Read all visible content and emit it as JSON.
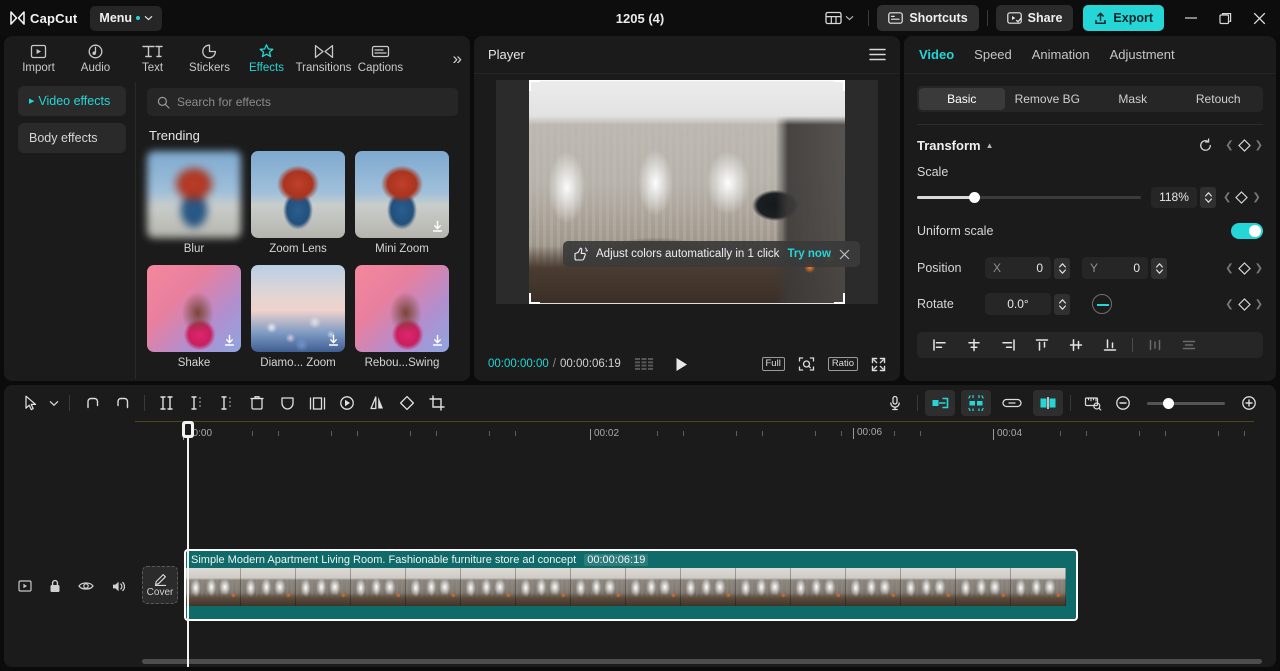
{
  "titlebar": {
    "brand": "CapCut",
    "menu_label": "Menu",
    "project_title": "1205 (4)",
    "layout_icon": "layout-icon",
    "shortcuts_label": "Shortcuts",
    "share_label": "Share",
    "export_label": "Export",
    "minimize": "minimize-icon",
    "maximize": "restore-icon",
    "close": "close-icon",
    "accent": "#25d6d6"
  },
  "nav": {
    "tabs": [
      {
        "label": "Import",
        "icon": "import-icon",
        "active": false
      },
      {
        "label": "Audio",
        "icon": "audio-icon",
        "active": false
      },
      {
        "label": "Text",
        "icon": "text-icon",
        "active": false
      },
      {
        "label": "Stickers",
        "icon": "stickers-icon",
        "active": false
      },
      {
        "label": "Effects",
        "icon": "effects-icon",
        "active": true
      },
      {
        "label": "Transitions",
        "icon": "transitions-icon",
        "active": false
      },
      {
        "label": "Captions",
        "icon": "captions-icon",
        "active": false
      }
    ],
    "more_label": "»"
  },
  "effects_panel": {
    "categories": [
      {
        "label": "Video effects",
        "active": true
      },
      {
        "label": "Body effects",
        "active": false
      }
    ],
    "search_placeholder": "Search for effects",
    "section_title": "Trending",
    "items": [
      {
        "name": "Blur",
        "thumb": "boy-blur",
        "download": false
      },
      {
        "name": "Zoom Lens",
        "thumb": "boy",
        "download": false
      },
      {
        "name": "Mini Zoom",
        "thumb": "boy",
        "download": true
      },
      {
        "name": "Shake",
        "thumb": "girl",
        "download": true
      },
      {
        "name": "Diamo... Zoom",
        "thumb": "bokeh",
        "download": true
      },
      {
        "name": "Rebou...Swing",
        "thumb": "girl",
        "download": true
      }
    ]
  },
  "player": {
    "title": "Player",
    "menu_icon": "hamburger-icon",
    "toast": {
      "text": "Adjust colors automatically in 1 click",
      "cta": "Try now",
      "icon": "magic-wand-icon",
      "close": "close-icon"
    },
    "current_time": "00:00:00:00",
    "separator": "/",
    "total_time": "00:00:06:19",
    "frames_icon": "frames-icon",
    "play_icon": "play-icon",
    "quality_label": "Full",
    "magnifier_icon": "zoom-fit-icon",
    "ratio_label": "Ratio",
    "fullscreen_icon": "fullscreen-icon"
  },
  "inspector": {
    "tabs": [
      {
        "label": "Video",
        "active": true
      },
      {
        "label": "Speed",
        "active": false
      },
      {
        "label": "Animation",
        "active": false
      },
      {
        "label": "Adjustment",
        "active": false
      }
    ],
    "segments": [
      {
        "label": "Basic",
        "active": true
      },
      {
        "label": "Remove BG",
        "active": false
      },
      {
        "label": "Mask",
        "active": false
      },
      {
        "label": "Retouch",
        "active": false
      }
    ],
    "transform": {
      "label": "Transform",
      "reset_icon": "reset-icon",
      "scale_label": "Scale",
      "scale_value": "118%",
      "scale_percent": 23,
      "uniform_scale_label": "Uniform scale",
      "uniform_scale_on": true,
      "position_label": "Position",
      "position_x_axis": "X",
      "position_x": "0",
      "position_y_axis": "Y",
      "position_y": "0",
      "rotate_label": "Rotate",
      "rotate_value": "0.0°"
    },
    "align_buttons": [
      "align-left-icon",
      "align-center-horizontal-icon",
      "align-right-icon",
      "align-top-icon",
      "align-middle-vertical-icon",
      "align-bottom-icon",
      "distribute-horizontal-icon",
      "distribute-vertical-icon"
    ]
  },
  "timeline": {
    "toolbar_left": [
      "select-tool-icon",
      "tool-dropdown-icon",
      "undo-icon",
      "redo-icon",
      "split-icon",
      "trim-left-icon",
      "trim-right-icon",
      "delete-icon",
      "mask-icon",
      "mirror-frame-icon",
      "keyframe-icon",
      "flip-icon",
      "rotate-icon",
      "crop-icon"
    ],
    "toolbar_right": [
      "microphone-icon",
      "auto-split-icon",
      "auto-cut-icon",
      "link-icon",
      "mixer-icon",
      "ruler-icon",
      "zoom-out-icon",
      "zoom-slider",
      "zoom-in-icon"
    ],
    "zoom_percent": 22,
    "ruler_marks": [
      "00:00",
      "00:02",
      "00:04",
      "00:06",
      "00"
    ],
    "playhead_time": "00:00:00:00",
    "track_controls": [
      "track-type-icon",
      "lock-icon",
      "visibility-icon",
      "mute-icon",
      "more-icon"
    ],
    "cover_label": "Cover",
    "cover_icon": "pencil-icon",
    "clip": {
      "name": "Simple Modern Apartment Living Room. Fashionable furniture store ad concept",
      "duration": "00:00:06:19",
      "color": "#0f6a6a",
      "frame_count": 16
    }
  }
}
